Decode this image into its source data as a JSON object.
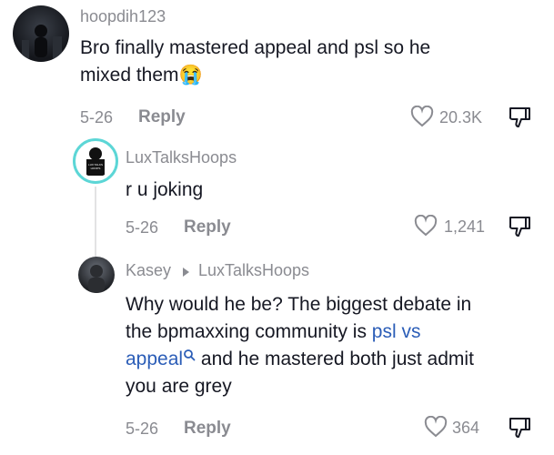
{
  "comments": [
    {
      "username": "hoopdih123",
      "text_line1": "Bro finally mastered appeal and psl so he",
      "text_line2": "mixed them",
      "emoji": "😭",
      "date": "5-26",
      "reply_label": "Reply",
      "likes": "20.3K"
    },
    {
      "username": "LuxTalksHoops",
      "avatar_text": "LUX TALKS HOOPS",
      "text": "r u joking",
      "date": "5-26",
      "reply_label": "Reply",
      "likes": "1,241"
    },
    {
      "username": "Kasey",
      "reply_to": "LuxTalksHoops",
      "text_line1": "Why would he be? The biggest debate in",
      "text_line2_prefix": "the bpmaxxing community is ",
      "link_part1": "psl vs",
      "link_part2": "appeal",
      "text_line3_suffix": " and he mastered both just admit",
      "text_line4": "you are grey",
      "date": "5-26",
      "reply_label": "Reply",
      "likes": "364"
    }
  ],
  "colors": {
    "text": "#161823",
    "secondary": "#8a8b91",
    "link": "#2b5db7",
    "ring": "#5cd6d6"
  },
  "icons": [
    "heart-icon",
    "dislike-icon",
    "search-icon",
    "caret-right-icon"
  ]
}
